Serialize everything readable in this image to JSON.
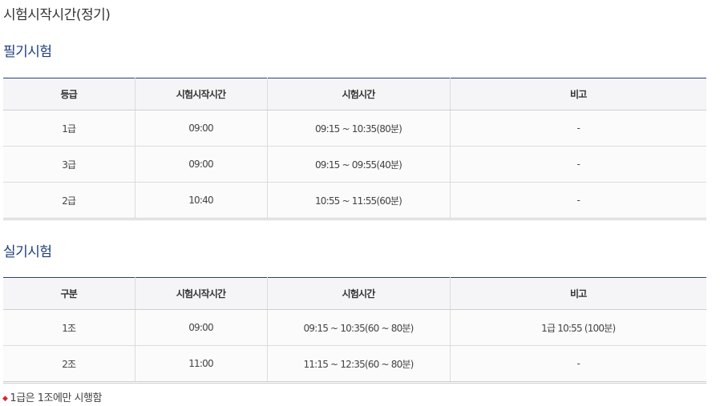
{
  "page_title": "시험시작시간(정기)",
  "written": {
    "title": "필기시험",
    "headers": [
      "등급",
      "시험시작시간",
      "시험시간",
      "비고"
    ],
    "rows": [
      [
        "1급",
        "09:00",
        "09:15 ~ 10:35(80분)",
        "-"
      ],
      [
        "3급",
        "09:00",
        "09:15 ~ 09:55(40분)",
        "-"
      ],
      [
        "2급",
        "10:40",
        "10:55 ~ 11:55(60분)",
        "-"
      ]
    ]
  },
  "practical": {
    "title": "실기시험",
    "headers": [
      "구분",
      "시험시작시간",
      "시험시간",
      "비고"
    ],
    "rows": [
      [
        "1조",
        "09:00",
        "09:15 ~ 10:35(60 ~ 80분)",
        "1급 10:55 (100분)"
      ],
      [
        "2조",
        "11:00",
        "11:15 ~ 12:35(60 ~ 80분)",
        "-"
      ]
    ]
  },
  "note": {
    "bullet_icon": "red-diamond-bullet",
    "text": "1급은 1조에만 시행함"
  }
}
